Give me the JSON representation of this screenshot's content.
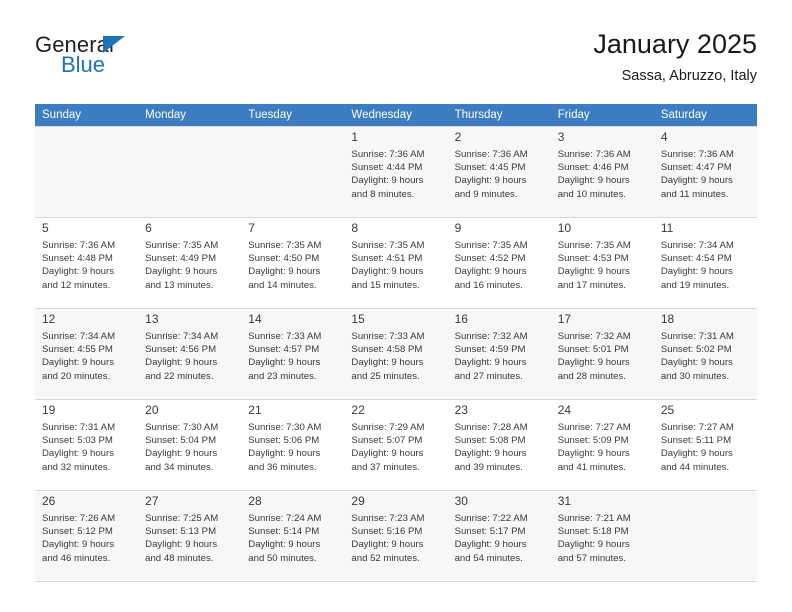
{
  "brand": {
    "name_part1": "General",
    "name_part2": "Blue",
    "accent_color": "#1f73b7",
    "triangle_icon": "brand-triangle-icon"
  },
  "header": {
    "title": "January 2025",
    "subtitle": "Sassa, Abruzzo, Italy"
  },
  "colors": {
    "header_row_bg": "#3b7dc0",
    "header_row_text": "#ffffff",
    "alt_row_bg": "#f7f7f7",
    "grid_line": "#d9d9d9",
    "text": "#3a3a3a"
  },
  "weekdays": [
    "Sunday",
    "Monday",
    "Tuesday",
    "Wednesday",
    "Thursday",
    "Friday",
    "Saturday"
  ],
  "labels": {
    "sunrise_prefix": "Sunrise:",
    "sunset_prefix": "Sunset:",
    "daylight_prefix": "Daylight:"
  },
  "weeks": [
    [
      {
        "day": "",
        "sunrise": "",
        "sunset": "",
        "daylight_line1": "",
        "daylight_line2": "",
        "empty": true
      },
      {
        "day": "",
        "sunrise": "",
        "sunset": "",
        "daylight_line1": "",
        "daylight_line2": "",
        "empty": true
      },
      {
        "day": "",
        "sunrise": "",
        "sunset": "",
        "daylight_line1": "",
        "daylight_line2": "",
        "empty": true
      },
      {
        "day": "1",
        "sunrise": "Sunrise: 7:36 AM",
        "sunset": "Sunset: 4:44 PM",
        "daylight_line1": "Daylight: 9 hours",
        "daylight_line2": "and 8 minutes."
      },
      {
        "day": "2",
        "sunrise": "Sunrise: 7:36 AM",
        "sunset": "Sunset: 4:45 PM",
        "daylight_line1": "Daylight: 9 hours",
        "daylight_line2": "and 9 minutes."
      },
      {
        "day": "3",
        "sunrise": "Sunrise: 7:36 AM",
        "sunset": "Sunset: 4:46 PM",
        "daylight_line1": "Daylight: 9 hours",
        "daylight_line2": "and 10 minutes."
      },
      {
        "day": "4",
        "sunrise": "Sunrise: 7:36 AM",
        "sunset": "Sunset: 4:47 PM",
        "daylight_line1": "Daylight: 9 hours",
        "daylight_line2": "and 11 minutes."
      }
    ],
    [
      {
        "day": "5",
        "sunrise": "Sunrise: 7:36 AM",
        "sunset": "Sunset: 4:48 PM",
        "daylight_line1": "Daylight: 9 hours",
        "daylight_line2": "and 12 minutes."
      },
      {
        "day": "6",
        "sunrise": "Sunrise: 7:35 AM",
        "sunset": "Sunset: 4:49 PM",
        "daylight_line1": "Daylight: 9 hours",
        "daylight_line2": "and 13 minutes."
      },
      {
        "day": "7",
        "sunrise": "Sunrise: 7:35 AM",
        "sunset": "Sunset: 4:50 PM",
        "daylight_line1": "Daylight: 9 hours",
        "daylight_line2": "and 14 minutes."
      },
      {
        "day": "8",
        "sunrise": "Sunrise: 7:35 AM",
        "sunset": "Sunset: 4:51 PM",
        "daylight_line1": "Daylight: 9 hours",
        "daylight_line2": "and 15 minutes."
      },
      {
        "day": "9",
        "sunrise": "Sunrise: 7:35 AM",
        "sunset": "Sunset: 4:52 PM",
        "daylight_line1": "Daylight: 9 hours",
        "daylight_line2": "and 16 minutes."
      },
      {
        "day": "10",
        "sunrise": "Sunrise: 7:35 AM",
        "sunset": "Sunset: 4:53 PM",
        "daylight_line1": "Daylight: 9 hours",
        "daylight_line2": "and 17 minutes."
      },
      {
        "day": "11",
        "sunrise": "Sunrise: 7:34 AM",
        "sunset": "Sunset: 4:54 PM",
        "daylight_line1": "Daylight: 9 hours",
        "daylight_line2": "and 19 minutes."
      }
    ],
    [
      {
        "day": "12",
        "sunrise": "Sunrise: 7:34 AM",
        "sunset": "Sunset: 4:55 PM",
        "daylight_line1": "Daylight: 9 hours",
        "daylight_line2": "and 20 minutes."
      },
      {
        "day": "13",
        "sunrise": "Sunrise: 7:34 AM",
        "sunset": "Sunset: 4:56 PM",
        "daylight_line1": "Daylight: 9 hours",
        "daylight_line2": "and 22 minutes."
      },
      {
        "day": "14",
        "sunrise": "Sunrise: 7:33 AM",
        "sunset": "Sunset: 4:57 PM",
        "daylight_line1": "Daylight: 9 hours",
        "daylight_line2": "and 23 minutes."
      },
      {
        "day": "15",
        "sunrise": "Sunrise: 7:33 AM",
        "sunset": "Sunset: 4:58 PM",
        "daylight_line1": "Daylight: 9 hours",
        "daylight_line2": "and 25 minutes."
      },
      {
        "day": "16",
        "sunrise": "Sunrise: 7:32 AM",
        "sunset": "Sunset: 4:59 PM",
        "daylight_line1": "Daylight: 9 hours",
        "daylight_line2": "and 27 minutes."
      },
      {
        "day": "17",
        "sunrise": "Sunrise: 7:32 AM",
        "sunset": "Sunset: 5:01 PM",
        "daylight_line1": "Daylight: 9 hours",
        "daylight_line2": "and 28 minutes."
      },
      {
        "day": "18",
        "sunrise": "Sunrise: 7:31 AM",
        "sunset": "Sunset: 5:02 PM",
        "daylight_line1": "Daylight: 9 hours",
        "daylight_line2": "and 30 minutes."
      }
    ],
    [
      {
        "day": "19",
        "sunrise": "Sunrise: 7:31 AM",
        "sunset": "Sunset: 5:03 PM",
        "daylight_line1": "Daylight: 9 hours",
        "daylight_line2": "and 32 minutes."
      },
      {
        "day": "20",
        "sunrise": "Sunrise: 7:30 AM",
        "sunset": "Sunset: 5:04 PM",
        "daylight_line1": "Daylight: 9 hours",
        "daylight_line2": "and 34 minutes."
      },
      {
        "day": "21",
        "sunrise": "Sunrise: 7:30 AM",
        "sunset": "Sunset: 5:06 PM",
        "daylight_line1": "Daylight: 9 hours",
        "daylight_line2": "and 36 minutes."
      },
      {
        "day": "22",
        "sunrise": "Sunrise: 7:29 AM",
        "sunset": "Sunset: 5:07 PM",
        "daylight_line1": "Daylight: 9 hours",
        "daylight_line2": "and 37 minutes."
      },
      {
        "day": "23",
        "sunrise": "Sunrise: 7:28 AM",
        "sunset": "Sunset: 5:08 PM",
        "daylight_line1": "Daylight: 9 hours",
        "daylight_line2": "and 39 minutes."
      },
      {
        "day": "24",
        "sunrise": "Sunrise: 7:27 AM",
        "sunset": "Sunset: 5:09 PM",
        "daylight_line1": "Daylight: 9 hours",
        "daylight_line2": "and 41 minutes."
      },
      {
        "day": "25",
        "sunrise": "Sunrise: 7:27 AM",
        "sunset": "Sunset: 5:11 PM",
        "daylight_line1": "Daylight: 9 hours",
        "daylight_line2": "and 44 minutes."
      }
    ],
    [
      {
        "day": "26",
        "sunrise": "Sunrise: 7:26 AM",
        "sunset": "Sunset: 5:12 PM",
        "daylight_line1": "Daylight: 9 hours",
        "daylight_line2": "and 46 minutes."
      },
      {
        "day": "27",
        "sunrise": "Sunrise: 7:25 AM",
        "sunset": "Sunset: 5:13 PM",
        "daylight_line1": "Daylight: 9 hours",
        "daylight_line2": "and 48 minutes."
      },
      {
        "day": "28",
        "sunrise": "Sunrise: 7:24 AM",
        "sunset": "Sunset: 5:14 PM",
        "daylight_line1": "Daylight: 9 hours",
        "daylight_line2": "and 50 minutes."
      },
      {
        "day": "29",
        "sunrise": "Sunrise: 7:23 AM",
        "sunset": "Sunset: 5:16 PM",
        "daylight_line1": "Daylight: 9 hours",
        "daylight_line2": "and 52 minutes."
      },
      {
        "day": "30",
        "sunrise": "Sunrise: 7:22 AM",
        "sunset": "Sunset: 5:17 PM",
        "daylight_line1": "Daylight: 9 hours",
        "daylight_line2": "and 54 minutes."
      },
      {
        "day": "31",
        "sunrise": "Sunrise: 7:21 AM",
        "sunset": "Sunset: 5:18 PM",
        "daylight_line1": "Daylight: 9 hours",
        "daylight_line2": "and 57 minutes."
      },
      {
        "day": "",
        "sunrise": "",
        "sunset": "",
        "daylight_line1": "",
        "daylight_line2": "",
        "empty": true
      }
    ]
  ]
}
